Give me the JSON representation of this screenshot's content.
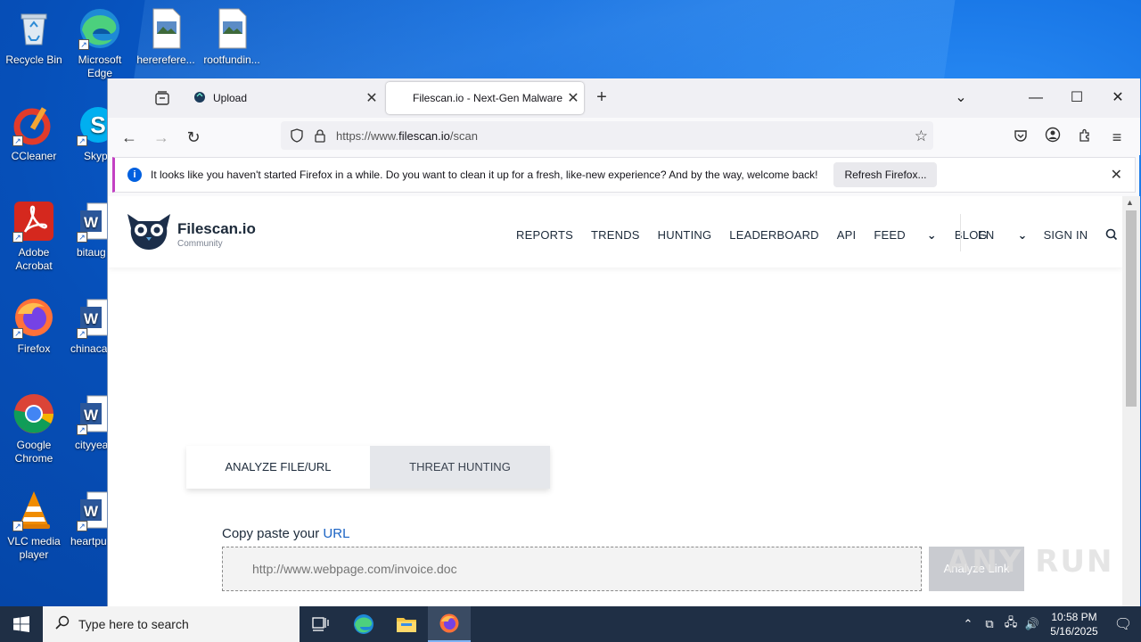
{
  "desktop": {
    "icons": [
      {
        "label": "Recycle Bin"
      },
      {
        "label": "Microsoft Edge"
      },
      {
        "label": "hererefere..."
      },
      {
        "label": "rootfundin..."
      },
      {
        "label": "CCleaner"
      },
      {
        "label": "Skyp"
      },
      {
        "label": "Adobe Acrobat"
      },
      {
        "label": "bitaug"
      },
      {
        "label": "Firefox"
      },
      {
        "label": "chinaca"
      },
      {
        "label": "Google Chrome"
      },
      {
        "label": "cityyea"
      },
      {
        "label": "VLC media player"
      },
      {
        "label": "heartpu"
      }
    ]
  },
  "browser": {
    "tabs": [
      {
        "title": "Upload"
      },
      {
        "title": "Filescan.io - Next-Gen Malware"
      }
    ],
    "url_prefix": "https://www.",
    "url_domain": "filescan.io",
    "url_path": "/scan",
    "notification": {
      "message": "It looks like you haven't started Firefox in a while. Do you want to clean it up for a fresh, like-new experience? And by the way, welcome back!",
      "button": "Refresh Firefox..."
    }
  },
  "site": {
    "brand": "Filescan.io",
    "brand_sub": "Community",
    "menu": [
      "REPORTS",
      "TRENDS",
      "HUNTING",
      "LEADERBOARD",
      "API",
      "FEED",
      "BLOG"
    ],
    "lang": "EN",
    "signin": "SIGN IN",
    "tabs": [
      "ANALYZE FILE/URL",
      "THREAT HUNTING"
    ],
    "copy_label": "Copy paste your ",
    "copy_link": "URL",
    "url_placeholder": "http://www.webpage.com/invoice.doc",
    "analyze_button": "Analyze Link"
  },
  "watermark": "ANY RUN",
  "taskbar": {
    "search_placeholder": "Type here to search",
    "time": "10:58 PM",
    "date": "5/16/2025"
  },
  "colors": {
    "accent_link": "#1a63c4",
    "notif_bar": "#c340c3",
    "taskbar": "#1f2f45"
  }
}
